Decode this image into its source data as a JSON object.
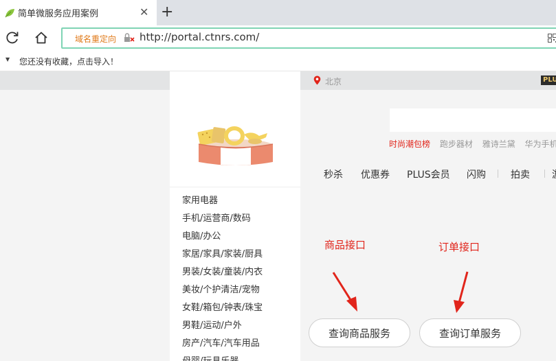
{
  "browser": {
    "tab_title": "简单微服务应用案例",
    "tab_close": "✕",
    "new_tab": "+",
    "redirect_label": "域名重定向",
    "url": "http://portal.ctnrs.com/",
    "bookmark_hint": "您还没有收藏，点击导入！",
    "accent_color": "#7fd4b4"
  },
  "page": {
    "location": "北京",
    "plus_badge": "PLU",
    "categories": [
      "家用电器",
      "手机/运营商/数码",
      "电脑/办公",
      "家居/家具/家装/厨具",
      "男装/女装/童装/内衣",
      "美妆/个护清洁/宠物",
      "女鞋/箱包/钟表/珠宝",
      "男鞋/运动/户外",
      "房产/汽车/汽车用品",
      "母婴/玩具乐器"
    ],
    "hotwords": [
      "时尚潮包榜",
      "跑步器材",
      "雅诗兰黛",
      "华为手机"
    ],
    "nav": [
      "秒杀",
      "优惠券",
      "PLUS会员",
      "闪购",
      "拍卖",
      "游"
    ],
    "annotations": {
      "product": "商品接口",
      "order": "订单接口",
      "color": "#e1251b"
    },
    "buttons": {
      "query_product": "查询商品服务",
      "query_order": "查询订单服务"
    }
  }
}
